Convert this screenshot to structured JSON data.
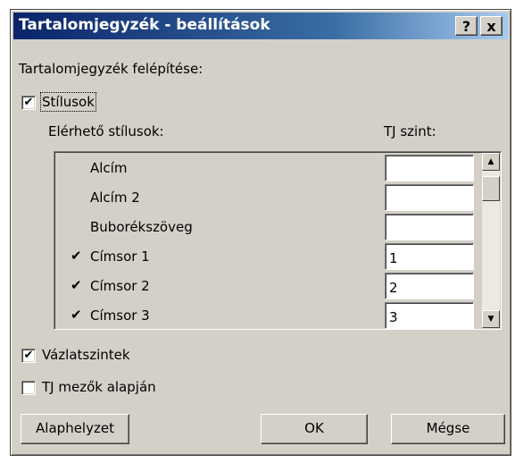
{
  "dialog": {
    "title": "Tartalomjegyzék - beállítások",
    "help_label": "?",
    "close_label": "x"
  },
  "section_label": "Tartalomjegyzék felépítése:",
  "styles_checkbox": {
    "label": "Stílusok",
    "checked": true
  },
  "available_styles_label": "Elérhető stílusok:",
  "level_column_label": "TJ szint:",
  "style_rows": [
    {
      "name": "Alcím",
      "tick": "",
      "level": ""
    },
    {
      "name": "Alcím 2",
      "tick": "",
      "level": ""
    },
    {
      "name": "Buborékszöveg",
      "tick": "",
      "level": ""
    },
    {
      "name": "Címsor 1",
      "tick": "✔",
      "level": "1"
    },
    {
      "name": "Címsor 2",
      "tick": "✔",
      "level": "2"
    },
    {
      "name": "Címsor 3",
      "tick": "✔",
      "level": "3"
    }
  ],
  "outline_checkbox": {
    "label": "Vázlatszintek",
    "checked": true
  },
  "fields_checkbox": {
    "label": "TJ mezők alapján",
    "checked": false
  },
  "checkmark": "✔",
  "buttons": {
    "reset": "Alaphelyzet",
    "ok": "OK",
    "cancel": "Mégse"
  }
}
